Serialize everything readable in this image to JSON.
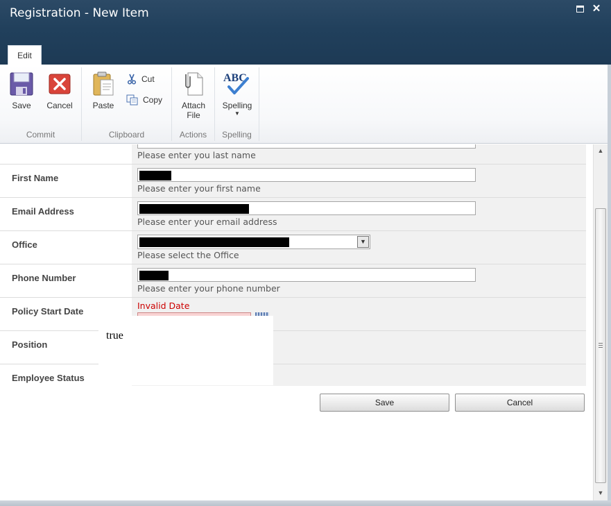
{
  "window": {
    "title": "Registration - New Item"
  },
  "ribbon": {
    "tab": "Edit",
    "groups": {
      "commit": {
        "label": "Commit",
        "save": "Save",
        "cancel": "Cancel"
      },
      "clipboard": {
        "label": "Clipboard",
        "paste": "Paste",
        "cut": "Cut",
        "copy": "Copy"
      },
      "actions": {
        "label": "Actions",
        "attach_line1": "Attach",
        "attach_line2": "File"
      },
      "spelling": {
        "label": "Spelling",
        "spelling": "Spelling",
        "abc": "ABC"
      }
    }
  },
  "form": {
    "last_name": {
      "hint": "Please enter you last name"
    },
    "first_name": {
      "label": "First Name",
      "hint": "Please enter your first name"
    },
    "email": {
      "label": "Email Address",
      "hint": "Please enter your email address"
    },
    "office": {
      "label": "Office",
      "hint": "Please select the Office"
    },
    "phone": {
      "label": "Phone Number",
      "hint": "Please enter your phone number"
    },
    "policy_start": {
      "label": "Policy Start Date",
      "error": "Invalid Date"
    },
    "position": {
      "label": "Position"
    },
    "employee_status": {
      "label": "Employee Status"
    },
    "overlay_text": "true"
  },
  "buttons": {
    "save": "Save",
    "cancel": "Cancel"
  },
  "colors": {
    "title_bar": "#21405c",
    "error": "#cc0000",
    "field_bg": "#f1f1f1"
  }
}
